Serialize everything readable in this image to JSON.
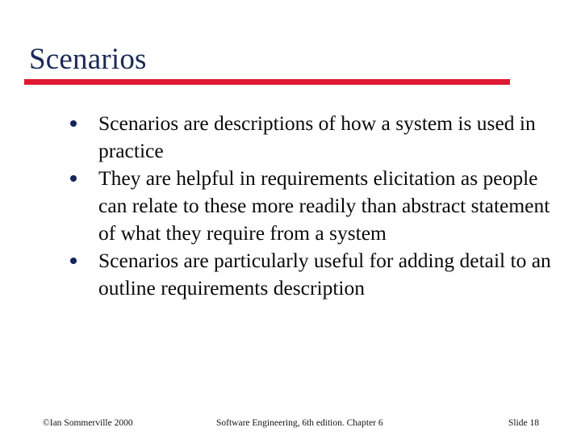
{
  "slide": {
    "title": "Scenarios",
    "accent_color": "#e01932",
    "title_color": "#1b2a57",
    "body_color": "#0a0a0a",
    "background_color": "#ffffff",
    "bullets": [
      "Scenarios are descriptions of how a system is used in practice",
      "They are helpful in requirements elicitation as people can relate to these more readily than abstract statement of what they require from a system",
      "Scenarios are particularly useful for adding detail to an outline requirements description"
    ]
  },
  "footer": {
    "copyright": "©Ian Sommerville 2000",
    "center": "Software Engineering, 6th edition. Chapter 6",
    "slide_number": "Slide  18"
  }
}
